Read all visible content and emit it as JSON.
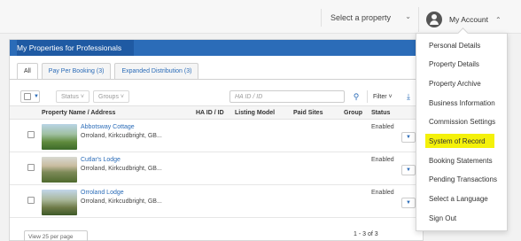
{
  "header": {
    "select_property": "Select a property",
    "account_label": "My Account"
  },
  "panel": {
    "title": "My Properties for Professionals",
    "tabs": [
      {
        "label": "All"
      },
      {
        "label": "Pay Per Booking  (3)"
      },
      {
        "label": "Expanded Distribution  (3)"
      }
    ]
  },
  "toolbar": {
    "status": "Status",
    "groups": "Groups",
    "search_placeholder": "HA ID / ID",
    "filter": "Filter"
  },
  "table": {
    "columns": {
      "name": "Property Name / Address",
      "ha_id": "HA ID / ID",
      "listing_model": "Listing Model",
      "paid_sites": "Paid Sites",
      "group": "Group",
      "status": "Status"
    },
    "rows": [
      {
        "name": "Abbotsway Cottage",
        "address": "Orroland, Kirkcudbright, GB...",
        "status": "Enabled"
      },
      {
        "name": "Cutlar's Lodge",
        "address": "Orroland, Kirkcudbright, GB...",
        "status": "Enabled"
      },
      {
        "name": "Orroland Lodge",
        "address": "Orroland, Kirkcudbright, GB...",
        "status": "Enabled"
      }
    ]
  },
  "footer": {
    "per_page": "View 25 per page",
    "pager": "1 - 3 of 3"
  },
  "menu": {
    "items": [
      {
        "label": "Personal Details"
      },
      {
        "label": "Property Details"
      },
      {
        "label": "Property Archive"
      },
      {
        "label": "Business Information"
      },
      {
        "label": "Commission Settings"
      },
      {
        "label": "System of Record"
      },
      {
        "label": "Booking Statements"
      },
      {
        "label": "Pending Transactions"
      },
      {
        "label": "Select a Language"
      },
      {
        "label": "Sign Out"
      }
    ],
    "highlight_color": "#f4f10a"
  },
  "colors": {
    "accent": "#2b6cb8"
  }
}
